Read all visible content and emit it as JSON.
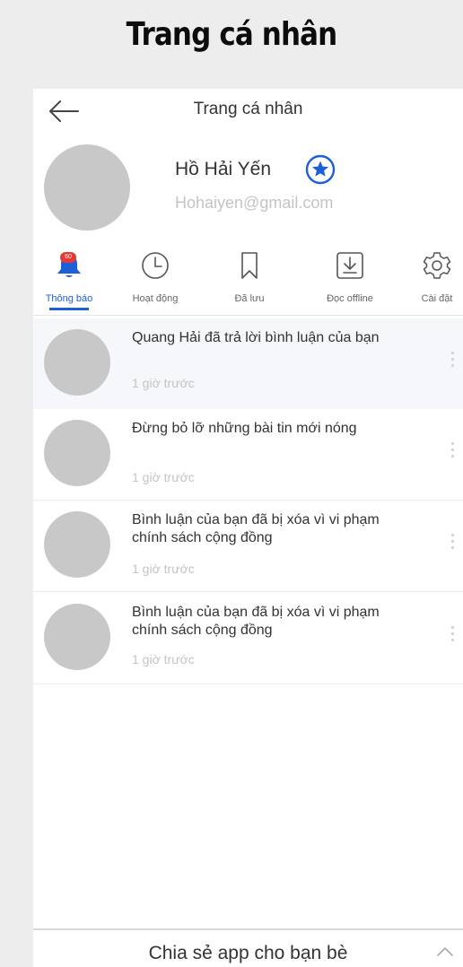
{
  "heading": "Trang cá nhân",
  "topbar": {
    "title": "Trang cá nhân",
    "back_icon": "arrow-left-icon"
  },
  "profile": {
    "name": "Hồ Hải Yến",
    "email": "Hohaiyen@gmail.com",
    "verified_icon": "star-badge-icon"
  },
  "tabs": [
    {
      "label": "Thông báo",
      "icon": "bell-icon",
      "badge": "60",
      "active": true
    },
    {
      "label": "Hoạt động",
      "icon": "clock-icon"
    },
    {
      "label": "Đã lưu",
      "icon": "bookmark-icon"
    },
    {
      "label": "Đọc offline",
      "icon": "download-icon"
    },
    {
      "label": "Cài đặt",
      "icon": "gear-icon"
    }
  ],
  "notifications": [
    {
      "text": "Quang Hải đã trả lời bình luận của bạn",
      "time": "1 giờ trước"
    },
    {
      "text": "Đừng bỏ lỡ những bài tin mới nóng",
      "time": "1 giờ trước"
    },
    {
      "text": "Bình luận của bạn đã bị xóa vì vi phạm chính sách cộng đồng",
      "time": "1 giờ trước"
    },
    {
      "text": "Bình luận của bạn đã bị xóa vì vi phạm chính sách cộng đồng",
      "time": "1 giờ trước"
    }
  ],
  "footer": {
    "label": "Chia sẻ app cho bạn bè",
    "icon": "chevron-up-icon"
  },
  "colors": {
    "accent": "#1c5fd8",
    "badge": "#e53935",
    "avatar": "#c8c8c8"
  }
}
